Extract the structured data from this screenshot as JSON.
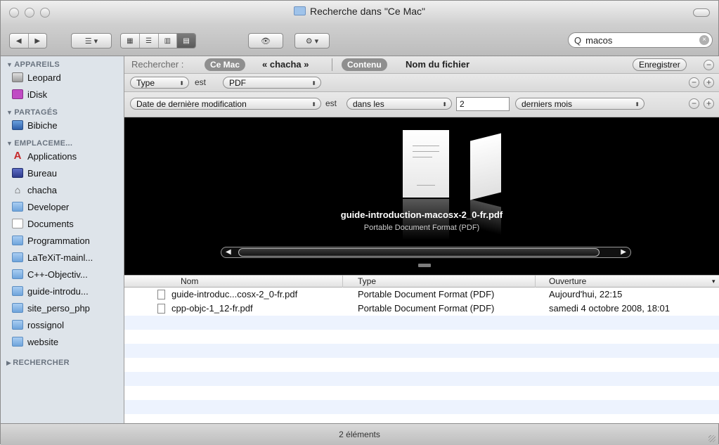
{
  "window": {
    "title": "Recherche dans \"Ce Mac\""
  },
  "toolbar": {
    "back": "◀",
    "forward": "▶",
    "arrange": "☰ ▾",
    "views": [
      "▦",
      "☰",
      "▥",
      "▤"
    ],
    "quicklook": "👁",
    "action": "⚙ ▾"
  },
  "search": {
    "value": "macos",
    "icon": "Q"
  },
  "sidebar": {
    "sections": [
      {
        "label": "APPAREILS",
        "items": [
          {
            "label": "Leopard",
            "icon": "disk"
          },
          {
            "label": "iDisk",
            "icon": "idisk"
          }
        ]
      },
      {
        "label": "PARTAGÉS",
        "items": [
          {
            "label": "Bibiche",
            "icon": "screen"
          }
        ]
      },
      {
        "label": "EMPLACEME...",
        "items": [
          {
            "label": "Applications",
            "icon": "app"
          },
          {
            "label": "Bureau",
            "icon": "desk"
          },
          {
            "label": "chacha",
            "icon": "home"
          },
          {
            "label": "Developer",
            "icon": "folder"
          },
          {
            "label": "Documents",
            "icon": "doc"
          },
          {
            "label": "Programmation",
            "icon": "folder"
          },
          {
            "label": "LaTeXiT-mainl...",
            "icon": "folder"
          },
          {
            "label": "C++-Objectiv...",
            "icon": "folder"
          },
          {
            "label": "guide-introdu...",
            "icon": "folder"
          },
          {
            "label": "site_perso_php",
            "icon": "folder"
          },
          {
            "label": "rossignol",
            "icon": "folder"
          },
          {
            "label": "website",
            "icon": "folder"
          }
        ]
      },
      {
        "label": "RECHERCHER",
        "items": []
      }
    ]
  },
  "scope": {
    "label": "Rechercher :",
    "this_mac": "Ce Mac",
    "user": "« chacha »",
    "contents": "Contenu",
    "filename": "Nom du fichier",
    "save": "Enregistrer",
    "minus": "−"
  },
  "criteria": [
    {
      "attribute": "Type",
      "verb": "est",
      "value": "PDF"
    },
    {
      "attribute": "Date de dernière modification",
      "verb": "est",
      "value": "dans les",
      "number": "2",
      "unit": "derniers mois"
    }
  ],
  "coverflow": {
    "title": "guide-introduction-macosx-2_0-fr.pdf",
    "subtitle": "Portable Document Format (PDF)"
  },
  "list": {
    "columns": [
      "Nom",
      "Type",
      "Ouverture"
    ],
    "rows": [
      {
        "name": "guide-introduc...cosx-2_0-fr.pdf",
        "type": "Portable Document Format (PDF)",
        "opened": "Aujourd'hui, 22:15"
      },
      {
        "name": "cpp-objc-1_12-fr.pdf",
        "type": "Portable Document Format (PDF)",
        "opened": "samedi 4 octobre 2008, 18:01"
      }
    ]
  },
  "status": {
    "text": "2 éléments"
  },
  "colors": {
    "sidebar_bg": "#dee4ea",
    "token_bg": "#8f8f8f",
    "alt_row": "#edf3fe"
  }
}
